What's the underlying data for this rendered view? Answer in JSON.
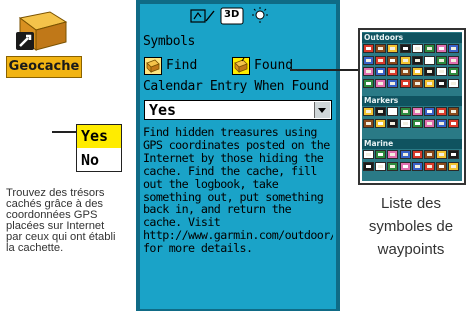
{
  "app": {
    "label": "Geocache",
    "icon": "geocache-app-icon"
  },
  "yes_no": {
    "yes": "Yes",
    "no": "No"
  },
  "left_caption": "Trouvez des trésors cachés grâce à des coordonnées GPS placées sur Internet par ceux qui ont établi la cachette.",
  "device": {
    "topbar_icons": [
      "signal-icon",
      "3d-map-icon",
      "backlight-icon"
    ],
    "topbar_3d_label": "3D",
    "symbols_label": "Symbols",
    "find_label": "Find",
    "found_label": "Found",
    "calendar_label": "Calendar Entry When Found",
    "calendar_value": "Yes",
    "description": "Find hidden treasures using GPS coordinates posted on the Internet by those hiding the cache. Find the cache, fill out the logbook, take something out, put something back in, and return the cache. Visit http://www.garmin.com/outdoor/geocaching/ for more details."
  },
  "symbols_panel": {
    "categories": [
      {
        "name": "Outdoors"
      },
      {
        "name": "Markers"
      },
      {
        "name": "Marine"
      }
    ]
  },
  "right_caption": "Liste des symboles de waypoints",
  "colors": {
    "screen_bg": "#1aa3c8",
    "device_bezel": "#0f6b86",
    "highlight": "#ffec00",
    "app_label_bg": "#f2b413",
    "panel_bg": "#2a7a86"
  }
}
